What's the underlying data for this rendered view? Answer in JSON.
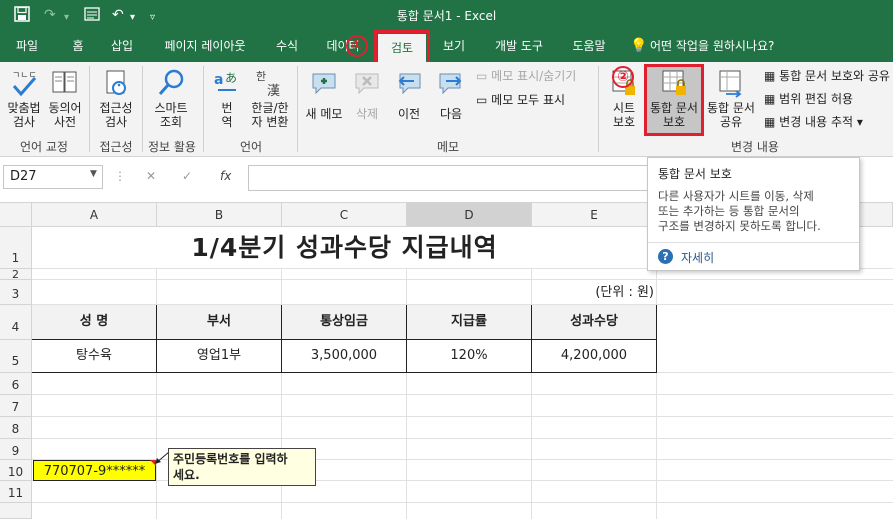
{
  "window": {
    "title": "통합 문서1  -  Excel"
  },
  "tabs": [
    "파일",
    "홈",
    "삽입",
    "페이지 레이아웃",
    "수식",
    "데이터",
    "검토",
    "보기",
    "개발 도구",
    "도움말"
  ],
  "tell_me": "어떤 작업을 원하시나요?",
  "annotations": {
    "circle1": "①",
    "circle2": "②"
  },
  "ribbon": {
    "spelling": {
      "line1": "맞춤법",
      "line2": "검사"
    },
    "thesaurus": {
      "line1": "동의어",
      "line2": "사전"
    },
    "group_proofing": "언어 교정",
    "accessibility": {
      "line1": "접근성",
      "line2": "검사"
    },
    "group_accessibility": "접근성",
    "smart_lookup": {
      "line1": "스마트",
      "line2": "조회"
    },
    "group_insights": "정보 활용",
    "translate": {
      "line1": "번",
      "line2": "역"
    },
    "hanja": {
      "line1": "한글/한",
      "line2": "자 변환"
    },
    "group_language": "언어",
    "new_comment": "새 메모",
    "delete": "삭제",
    "prev": "이전",
    "next": "다음",
    "show_hide_comment": "메모 표시/숨기기",
    "show_all_comments": "메모 모두 표시",
    "group_comments": "메모",
    "protect_sheet": {
      "line1": "시트",
      "line2": "보호"
    },
    "protect_workbook": {
      "line1": "통합 문서",
      "line2": "보호"
    },
    "share_workbook": {
      "line1": "통합 문서",
      "line2": "공유"
    },
    "protect_share": "통합 문서 보호와 공유",
    "allow_edit_ranges": "범위 편집 허용",
    "track_changes": "변경 내용 추적",
    "group_changes": "변경 내용"
  },
  "formula_bar": {
    "name_box": "D27",
    "fx": "fx",
    "cancel": "✕",
    "enter": "✓"
  },
  "tooltip": {
    "title": "통합 문서 보호",
    "line1": "다른 사용자가 시트를 이동, 삭제",
    "line2": "또는 추가하는 등 통합 문서의",
    "line3": "구조를 변경하지 못하도록 합니다.",
    "more": "자세히"
  },
  "columns": [
    "A",
    "B",
    "C",
    "D",
    "E"
  ],
  "rows": [
    "1",
    "2",
    "3",
    "4",
    "5",
    "6",
    "7",
    "8",
    "9",
    "10",
    "11"
  ],
  "sheet": {
    "title": "1/4분기 성과수당 지급내역",
    "unit": "(단위 : 원)",
    "headers": [
      "성  명",
      "부서",
      "통상임금",
      "지급률",
      "성과수당"
    ],
    "row": [
      "탕수육",
      "영업1부",
      "3,500,000",
      "120%",
      "4,200,000"
    ],
    "a10": "770707-9******",
    "comment_line1": "주민등록번호를 입력하",
    "comment_line2": "세요."
  },
  "colors": {
    "excel_green": "#217346",
    "highlight_red": "#e0202f",
    "cell_yellow": "#ffff00"
  }
}
